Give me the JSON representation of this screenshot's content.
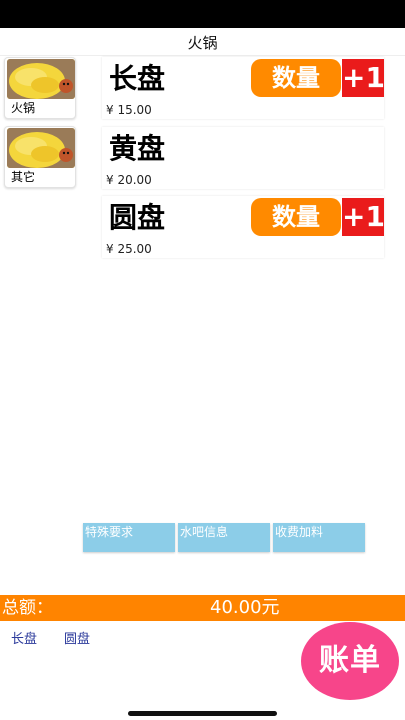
{
  "nav": {
    "title": "火锅"
  },
  "sidebar": {
    "items": [
      {
        "label": "火锅",
        "thumb_icon": "dish-photo-icon"
      },
      {
        "label": "其它",
        "thumb_icon": "dish-photo-icon"
      }
    ]
  },
  "products": [
    {
      "name": "长盘",
      "price": "¥ 15.00",
      "qty_label": "数量",
      "add_label": "+1"
    },
    {
      "name": "黄盘",
      "price": "¥ 20.00"
    },
    {
      "name": "圆盘",
      "price": "¥ 25.00",
      "qty_label": "数量",
      "add_label": "+1"
    }
  ],
  "options": [
    {
      "label": "特殊要求"
    },
    {
      "label": "水吧信息"
    },
    {
      "label": "收费加料"
    }
  ],
  "total": {
    "label": "总额：",
    "value": "40.00元"
  },
  "selected_items": [
    "长盘",
    "圆盘"
  ],
  "bill_button": {
    "label": "账单"
  },
  "colors": {
    "accent_orange": "#ff8400",
    "add_red": "#ea1b1b",
    "option_blue": "#8ccde8",
    "bill_pink": "#f7458a",
    "selected_text": "#2b3a9b"
  }
}
